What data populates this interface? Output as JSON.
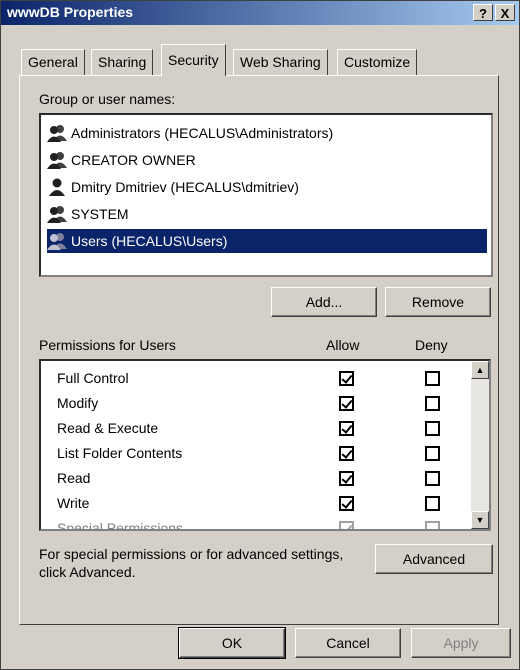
{
  "window": {
    "title": "wwwDB Properties",
    "help_label": "?",
    "close_label": "X"
  },
  "tabs": [
    {
      "label": "General"
    },
    {
      "label": "Sharing"
    },
    {
      "label": "Security"
    },
    {
      "label": "Web Sharing"
    },
    {
      "label": "Customize"
    }
  ],
  "groups": {
    "label": "Group or user names:",
    "items": [
      {
        "name": "Administrators (HECALUS\\Administrators)",
        "icon": "group-icon"
      },
      {
        "name": "CREATOR OWNER",
        "icon": "group-icon"
      },
      {
        "name": "Dmitry Dmitriev (HECALUS\\dmitriev)",
        "icon": "user-icon"
      },
      {
        "name": "SYSTEM",
        "icon": "group-icon"
      },
      {
        "name": "Users (HECALUS\\Users)",
        "icon": "group-icon",
        "selected": true
      }
    ]
  },
  "buttons": {
    "add": "Add...",
    "remove": "Remove",
    "advanced": "Advanced",
    "ok": "OK",
    "cancel": "Cancel",
    "apply": "Apply"
  },
  "permissions": {
    "label": "Permissions for Users",
    "allow_header": "Allow",
    "deny_header": "Deny",
    "rows": [
      {
        "name": "Full Control",
        "allow": true,
        "deny": false
      },
      {
        "name": "Modify",
        "allow": true,
        "deny": false
      },
      {
        "name": "Read & Execute",
        "allow": true,
        "deny": false
      },
      {
        "name": "List Folder Contents",
        "allow": true,
        "deny": false
      },
      {
        "name": "Read",
        "allow": true,
        "deny": false
      },
      {
        "name": "Write",
        "allow": true,
        "deny": false
      },
      {
        "name": "Special Permissions",
        "allow": true,
        "deny": false,
        "disabled": true
      }
    ]
  },
  "advanced_note": {
    "line1": "For special permissions or for advanced settings,",
    "line2": "click Advanced."
  },
  "colors": {
    "titlebar": "#0a246a",
    "face": "#d4d0c8",
    "selection": "#0a246a"
  }
}
